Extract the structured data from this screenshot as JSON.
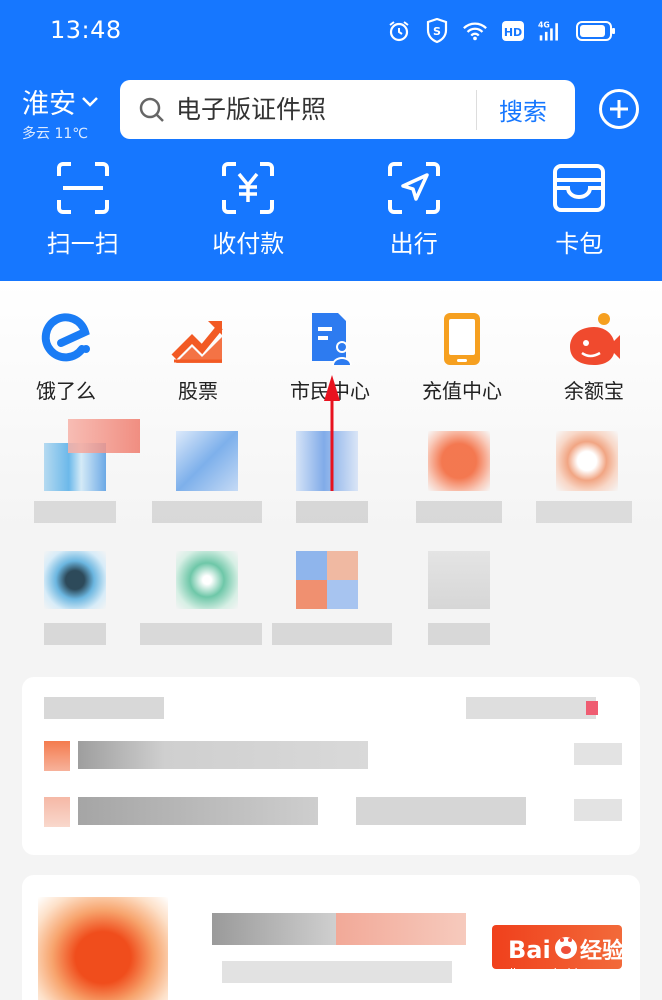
{
  "status_bar": {
    "time": "13:48",
    "icons": [
      "alarm-icon",
      "shield-icon",
      "wifi-icon",
      "hd-icon",
      "signal-4g-icon",
      "battery-icon"
    ],
    "network_label": "4G",
    "hd_label": "HD"
  },
  "location": {
    "city": "淮安",
    "weather": "多云 11℃"
  },
  "search": {
    "placeholder": "电子版证件照",
    "button_label": "搜索"
  },
  "quick_actions": [
    {
      "label": "扫一扫",
      "icon": "scan-icon"
    },
    {
      "label": "收付款",
      "icon": "payment-icon"
    },
    {
      "label": "出行",
      "icon": "navigation-icon"
    },
    {
      "label": "卡包",
      "icon": "card-wallet-icon"
    }
  ],
  "apps": [
    {
      "label": "饿了么",
      "icon": "eleme-icon"
    },
    {
      "label": "股票",
      "icon": "stock-icon"
    },
    {
      "label": "市民中心",
      "icon": "citizen-center-icon"
    },
    {
      "label": "充值中心",
      "icon": "recharge-icon"
    },
    {
      "label": "余额宝",
      "icon": "yuebao-icon"
    }
  ],
  "watermark": {
    "brand": "Bai",
    "suffix": "经验",
    "url": "jingyan.baidu.com"
  },
  "colors": {
    "header_blue": "#1677ff",
    "eleme_blue": "#1a7cf5",
    "stock_orange": "#f25a24",
    "citizen_blue": "#2d7bf0",
    "recharge_orange": "#f6a020",
    "yuebao_red": "#f04a2e",
    "arrow_red": "#e8121f"
  }
}
